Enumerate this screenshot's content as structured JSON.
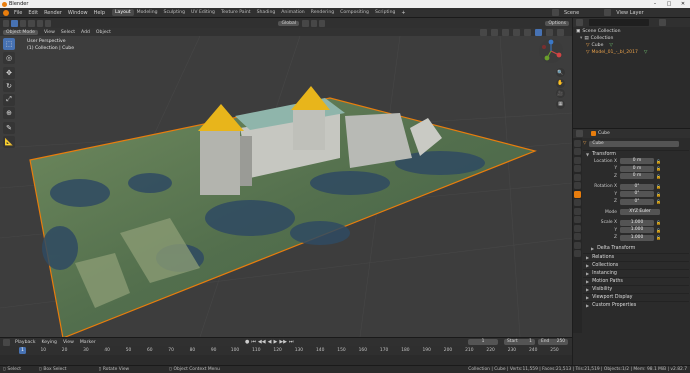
{
  "window": {
    "title": "Blender"
  },
  "menus": [
    "File",
    "Edit",
    "Render",
    "Window",
    "Help"
  ],
  "workspaces": [
    "Layout",
    "Modeling",
    "Sculpting",
    "UV Editing",
    "Texture Paint",
    "Shading",
    "Animation",
    "Rendering",
    "Compositing",
    "Scripting"
  ],
  "active_workspace": "Layout",
  "scene": {
    "label": "Scene",
    "view_layer": "View Layer"
  },
  "viewport": {
    "mode": "Object Mode",
    "menus": [
      "View",
      "Select",
      "Add",
      "Object"
    ],
    "transform": "Global",
    "options": "Options",
    "overlay_line1": "User Perspective",
    "overlay_line2": "(1) Collection | Cube"
  },
  "outliner": {
    "title": "Scene Collection",
    "items": [
      {
        "label": "Collection"
      },
      {
        "label": "Cube"
      },
      {
        "label": "Model_01_-_bl_2017"
      }
    ]
  },
  "properties": {
    "header_object": "Cube",
    "object_name": "Cube",
    "transform": {
      "title": "Transform",
      "location": {
        "label": "Location X",
        "y": "Y",
        "z": "Z",
        "values": [
          "0 m",
          "0 m",
          "0 m"
        ]
      },
      "rotation": {
        "label": "Rotation X",
        "y": "Y",
        "z": "Z",
        "values": [
          "0°",
          "0°",
          "0°"
        ]
      },
      "mode": {
        "label": "Mode",
        "value": "XYZ Euler"
      },
      "scale": {
        "label": "Scale X",
        "y": "Y",
        "z": "Z",
        "values": [
          "1.000",
          "1.000",
          "1.000"
        ]
      }
    },
    "delta": "Delta Transform",
    "panels": [
      "Relations",
      "Collections",
      "Instancing",
      "Motion Paths",
      "Visibility",
      "Viewport Display",
      "Custom Properties"
    ]
  },
  "timeline": {
    "menus": [
      "Playback",
      "Keying",
      "View",
      "Marker"
    ],
    "current_frame": "1",
    "start_label": "Start",
    "start": "1",
    "end_label": "End",
    "end": "250",
    "ticks": [
      "1",
      "10",
      "20",
      "30",
      "40",
      "50",
      "60",
      "70",
      "80",
      "90",
      "100",
      "110",
      "120",
      "130",
      "140",
      "150",
      "160",
      "170",
      "180",
      "190",
      "200",
      "210",
      "220",
      "230",
      "240",
      "250"
    ]
  },
  "status": {
    "select": "Select",
    "box_select": "Box Select",
    "rotate": "Rotate View",
    "context": "Object Context Menu",
    "stats": "Collection | Cube | Verts:11,559 | Faces:21,513 | Tris:21,519 | Objects:1/2 | Mem: 98.1 MiB | v2.82.7"
  },
  "colors": {
    "accent": "#4772b3",
    "selection": "#e87d0d",
    "bg": "#3d3d3d"
  }
}
